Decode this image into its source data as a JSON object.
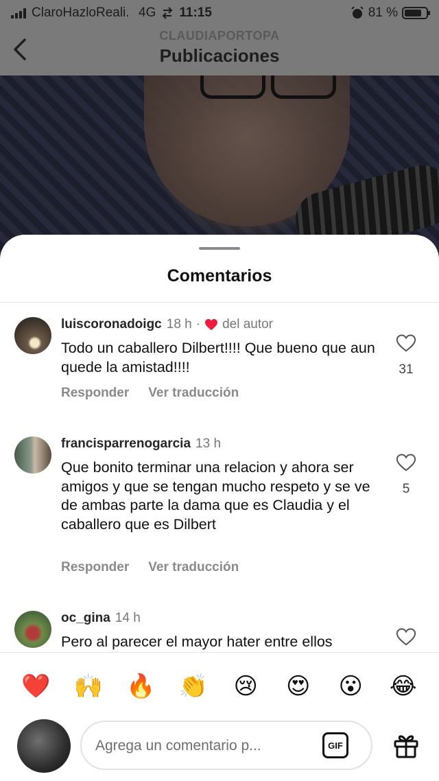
{
  "status_bar": {
    "carrier": "ClaroHazloReali...",
    "network": "4G",
    "time": "11:15",
    "battery_percent": "81 %",
    "battery_level": 0.81
  },
  "header": {
    "account": "CLAUDIAPORTOPA",
    "title": "Publicaciones"
  },
  "sheet": {
    "title": "Comentarios"
  },
  "comments": [
    {
      "username": "luiscoronadoigc",
      "time": "18 h",
      "separator": "·",
      "author_like": "del autor",
      "text": "Todo un caballero Dilbert!!!! Que bueno que aun quede la amistad!!!!",
      "likes": "31",
      "reply_label": "Responder",
      "translate_label": "Ver traducción"
    },
    {
      "username": "francisparrenogarcia",
      "time": "13 h",
      "text": "Que bonito terminar una relacion y ahora ser amigos y que se tengan mucho respeto y se ve de ambas parte la dama que es Claudia y el caballero que es Dilbert",
      "likes": "5",
      "reply_label": "Responder",
      "translate_label": "Ver traducción"
    },
    {
      "username": "oc_gina",
      "time": "14 h",
      "text": "Pero al parecer el mayor hater entre ellos"
    }
  ],
  "emoji_bar": [
    "❤️",
    "🙌",
    "🔥",
    "👏",
    "😢",
    "😍",
    "😮",
    "😂"
  ],
  "composer": {
    "placeholder": "Agrega un comentario p...",
    "gif_label": "GIF"
  },
  "colors": {
    "heart": "#ed1c3a",
    "muted_text": "#8a8a8a",
    "overlay": "#7a7a7a"
  },
  "icons": [
    "back-chevron-icon",
    "heart-icon",
    "gif-icon",
    "gift-icon"
  ]
}
